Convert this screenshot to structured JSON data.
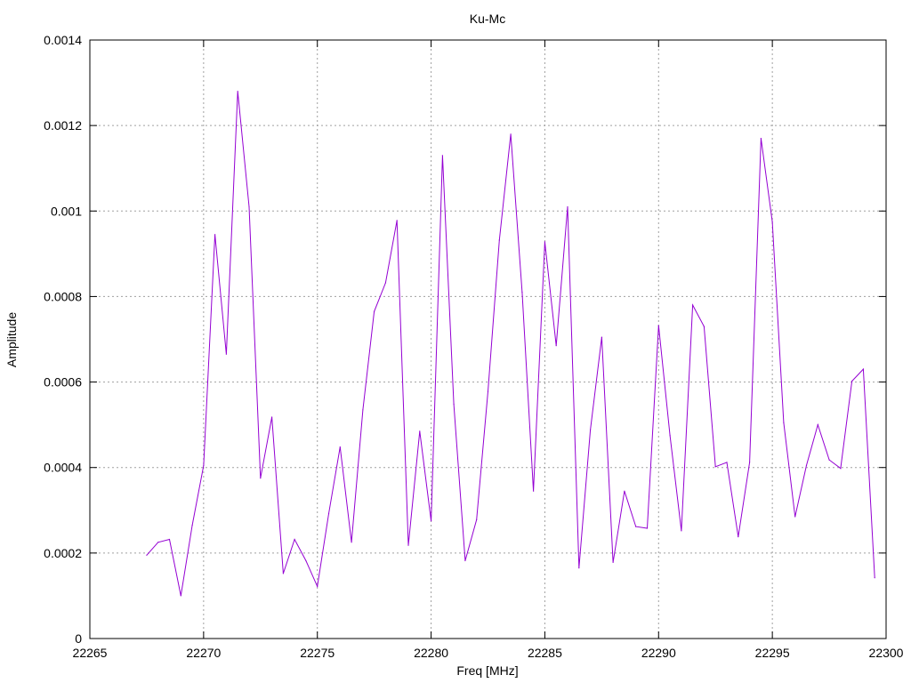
{
  "chart_data": {
    "type": "line",
    "title": "Ku-Mc",
    "xlabel": "Freq [MHz]",
    "ylabel": "Amplitude",
    "xlim": [
      22265,
      22300
    ],
    "ylim": [
      0,
      0.0014
    ],
    "x_ticks": [
      22265,
      22270,
      22275,
      22280,
      22285,
      22290,
      22295,
      22300
    ],
    "x_tick_labels": [
      "22265",
      "22270",
      "22275",
      "22280",
      "22285",
      "22290",
      "22295",
      "22300"
    ],
    "y_ticks": [
      0,
      0.0002,
      0.0004,
      0.0006,
      0.0008,
      0.001,
      0.0012,
      0.0014
    ],
    "y_tick_labels": [
      "0",
      "0.0002",
      "0.0004",
      "0.0006",
      "0.0008",
      "0.001",
      "0.0012",
      "0.0014"
    ],
    "grid": true,
    "series": [
      {
        "color": "#9400d3",
        "x": [
          22267.5,
          22268,
          22268.5,
          22269,
          22269.5,
          22270,
          22270.5,
          22271,
          22271.5,
          22272,
          22272.5,
          22273,
          22273.5,
          22274,
          22274.5,
          22275,
          22275.5,
          22276,
          22276.5,
          22277,
          22277.5,
          22278,
          22278.5,
          22279,
          22279.5,
          22280,
          22280.5,
          22281,
          22281.5,
          22282,
          22282.5,
          22283,
          22283.5,
          22284,
          22284.5,
          22285,
          22285.5,
          22286,
          22286.5,
          22287,
          22287.5,
          22288,
          22288.5,
          22289,
          22289.5,
          22290,
          22290.5,
          22291,
          22291.5,
          22292,
          22292.5,
          22293,
          22293.5,
          22294,
          22294.5,
          22295,
          22295.5,
          22296,
          22296.5,
          22297,
          22297.5,
          22298,
          22298.5,
          22299,
          22299.5
        ],
        "y": [
          0.000195,
          0.000225,
          0.000232,
          0.0001,
          0.000265,
          0.000405,
          0.000945,
          0.000665,
          0.00128,
          0.00101,
          0.000375,
          0.000518,
          0.000152,
          0.000232,
          0.000182,
          0.000122,
          0.000292,
          0.000448,
          0.000225,
          0.000535,
          0.000765,
          0.000832,
          0.000978,
          0.000218,
          0.000485,
          0.000275,
          0.00113,
          0.000548,
          0.000182,
          0.000278,
          0.000578,
          0.000932,
          0.00118,
          0.00081,
          0.000345,
          0.000928,
          0.000685,
          0.00101,
          0.000165,
          0.000488,
          0.000705,
          0.000178,
          0.000345,
          0.000262,
          0.000258,
          0.000732,
          0.000475,
          0.000252,
          0.00078,
          0.00073,
          0.000402,
          0.000412,
          0.000238,
          0.000412,
          0.00117,
          0.000975,
          0.000505,
          0.000285,
          0.000405,
          0.0005,
          0.000418,
          0.000398,
          0.000602,
          0.00063,
          0.000142
        ]
      }
    ]
  }
}
